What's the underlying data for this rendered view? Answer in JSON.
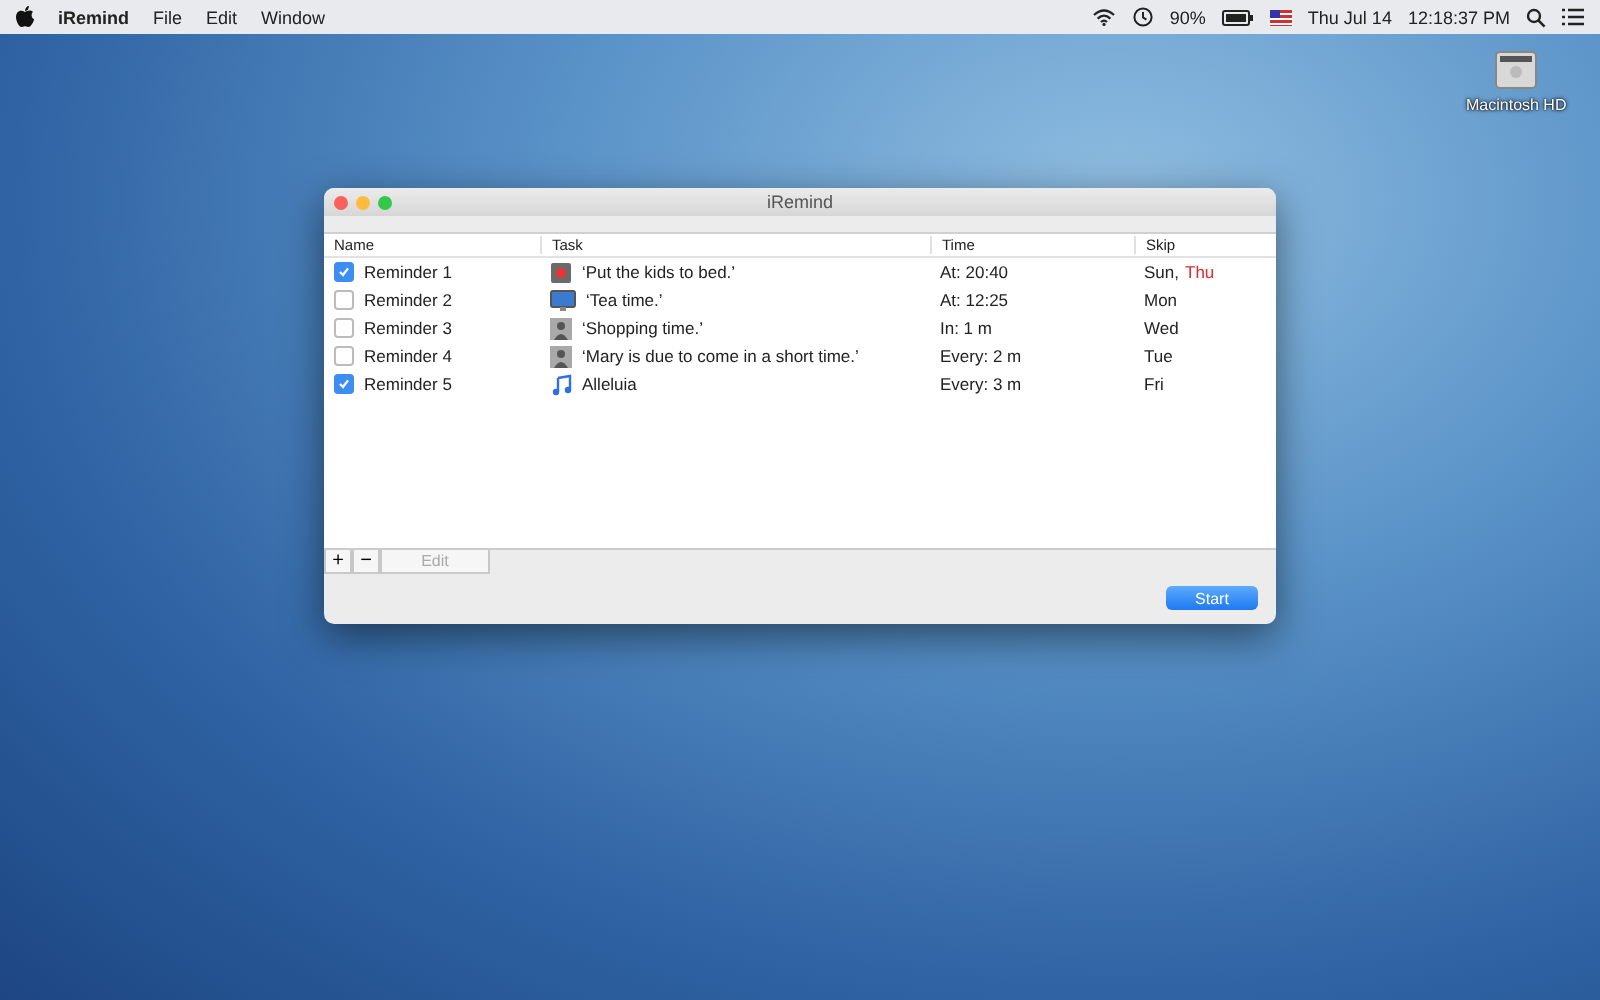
{
  "menu_bar": {
    "app_name": "iRemind",
    "menus": [
      "File",
      "Edit",
      "Window"
    ],
    "battery": "90%",
    "date": "Thu Jul 14",
    "time": "12:18:37 PM"
  },
  "desktop": {
    "disk_label": "Macintosh HD"
  },
  "window": {
    "title": "iRemind",
    "table": {
      "columns": [
        "Name",
        "Task",
        "Time",
        "Skip"
      ],
      "rows": [
        {
          "name": "Reminder 1",
          "checked": true,
          "kind": "record",
          "task": "‘Put the kids to bed.’",
          "time": "At: 20:40",
          "skip": [
            {
              "text": "Sun,",
              "highlighted": false
            },
            {
              "text": "Thu",
              "highlighted": true
            }
          ]
        },
        {
          "name": "Reminder 2",
          "checked": false,
          "kind": "display",
          "task": "‘Tea time.’",
          "time": "At: 12:25",
          "skip": [
            {
              "text": "Mon",
              "highlighted": false
            }
          ]
        },
        {
          "name": "Reminder 3",
          "checked": false,
          "kind": "speech",
          "task": "‘Shopping time.’",
          "time": "In: 1 m",
          "skip": [
            {
              "text": "Wed",
              "highlighted": false
            }
          ]
        },
        {
          "name": "Reminder 4",
          "checked": false,
          "kind": "speech",
          "task": "‘Mary is due to come in a short time.’",
          "time": "Every: 2 m",
          "skip": [
            {
              "text": "Tue",
              "highlighted": false
            }
          ]
        },
        {
          "name": "Reminder 5",
          "checked": true,
          "kind": "music",
          "task": "Alleluia",
          "time": "Every: 3 m",
          "skip": [
            {
              "text": "Fri",
              "highlighted": false
            }
          ]
        }
      ]
    },
    "add_button": "+",
    "remove_button": "−",
    "edit_button": {
      "label": "Edit",
      "disabled": true
    },
    "start_button": "Start"
  }
}
